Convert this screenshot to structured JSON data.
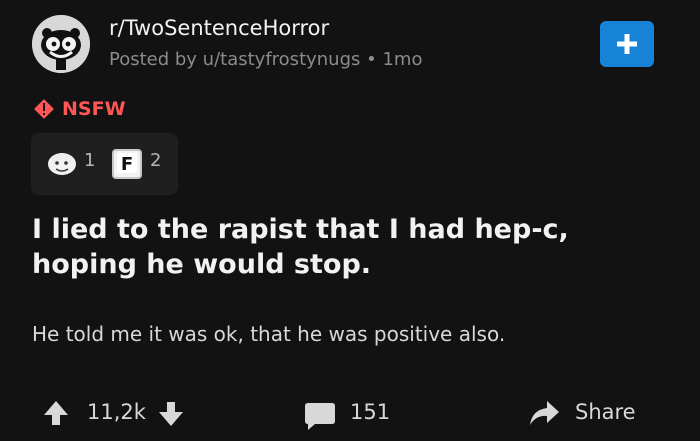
{
  "post": {
    "subreddit": "r/TwoSentenceHorror",
    "meta": "Posted by u/tastyfrostynugs • 1mo",
    "nsfw_label": "NSFW",
    "title": "I lied to the rapist that I had hep-c, hoping he would stop.",
    "body": "He told me it was ok, that he was positive also."
  },
  "awards": [
    {
      "icon": "wholesome-award-icon",
      "count": "1"
    },
    {
      "icon": "f-key-award-icon",
      "count": "2"
    }
  ],
  "actions": {
    "votes": "11,2k",
    "comments": "151",
    "share": "Share"
  },
  "icons": {
    "avatar": "snoo-avatar",
    "join": "plus-icon",
    "nsfw": "warning-icon",
    "upvote": "upvote-arrow-icon",
    "downvote": "downvote-arrow-icon",
    "comments": "comment-icon",
    "share": "share-arrow-icon"
  },
  "colors": {
    "background": "#121212",
    "accent": "#1683d6",
    "nsfw": "#ff5757",
    "award_background": "#1f1f1f"
  }
}
